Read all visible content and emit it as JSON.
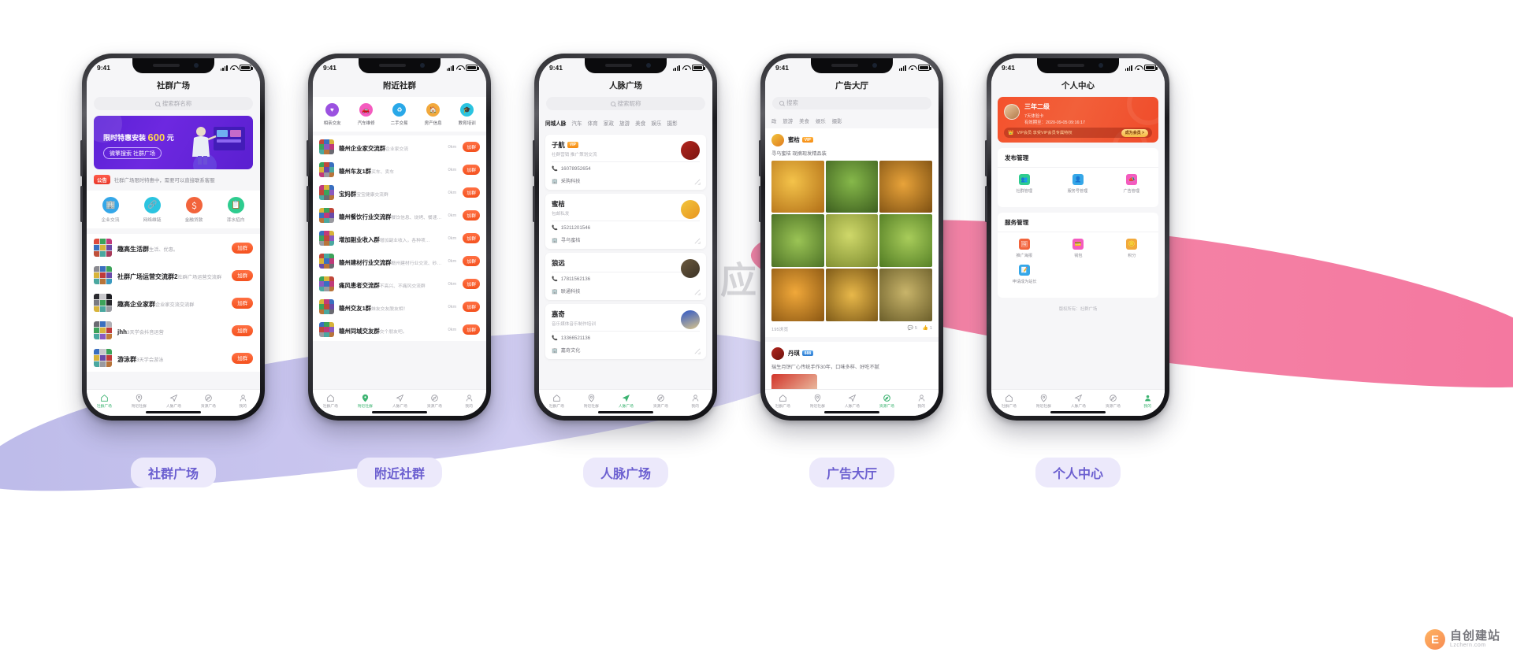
{
  "watermark": "微擎应用商城",
  "corner_logo": {
    "mark": "E",
    "line1": "自创建站",
    "line2": "Lzchern.com"
  },
  "status_bar": {
    "time": "9:41"
  },
  "captions": [
    "社群广场",
    "附近社群",
    "人脉广场",
    "广告大厅",
    "个人中心"
  ],
  "tabbar": {
    "items": [
      {
        "label": "社群广场",
        "icon": "home-icon"
      },
      {
        "label": "附近社群",
        "icon": "location-icon"
      },
      {
        "label": "人脉广场",
        "icon": "send-icon"
      },
      {
        "label": "资源广场",
        "icon": "compass-icon"
      },
      {
        "label": "我的",
        "icon": "user-icon"
      }
    ]
  },
  "phone1": {
    "title": "社群广场",
    "search_placeholder": "搜索群名称",
    "banner": {
      "line1_prefix": "限时特惠安装",
      "line1_num": "600",
      "line1_suffix": "元",
      "pill": "微擎搜索  社群广场"
    },
    "notice": {
      "tag": "公告",
      "text": "社群广场限时特惠中，需要可以直接联系客服"
    },
    "quick_entries": [
      {
        "label": "企业交流",
        "color": "#35a7e8",
        "glyph": "🏢"
      },
      {
        "label": "网络维链",
        "color": "#2bc4e0",
        "glyph": "🔗"
      },
      {
        "label": "金融贷款",
        "color": "#f2643c",
        "glyph": "$"
      },
      {
        "label": "漆水招白",
        "color": "#2ecc8f",
        "glyph": "📋"
      }
    ],
    "groups": [
      {
        "name": "趣高生活群",
        "desc": "生活、优惠。",
        "button": "加群"
      },
      {
        "name": "社群广场运营交流群2",
        "desc": "社群广场运营交流群",
        "button": "加群"
      },
      {
        "name": "趣高企业家群",
        "desc": "企业家交流交流群",
        "button": "加群"
      },
      {
        "name": "jhh",
        "desc": "3天学会抖音运营",
        "button": "加群"
      },
      {
        "name": "游泳群",
        "desc": "3天学会游泳",
        "button": "加群"
      }
    ],
    "active_tab": 0
  },
  "phone2": {
    "title": "附近社群",
    "categories": [
      {
        "label": "相亲交友",
        "color": "#9b51e0",
        "glyph": "♥"
      },
      {
        "label": "汽车维修",
        "color": "#f45bbf",
        "glyph": "🚗"
      },
      {
        "label": "二手交易",
        "color": "#29a8e8",
        "glyph": "♻"
      },
      {
        "label": "房产信息",
        "color": "#f2a93c",
        "glyph": "🏠"
      },
      {
        "label": "教育培训",
        "color": "#2bc4e0",
        "glyph": "🎓"
      }
    ],
    "groups": [
      {
        "name": "赣州企业家交流群",
        "desc": "企业家交流",
        "dist": "0km",
        "button": "加群"
      },
      {
        "name": "赣州车友1群",
        "desc": "买车、卖车",
        "dist": "0km",
        "button": "加群"
      },
      {
        "name": "宝妈群",
        "desc": "宝宝健康交流群",
        "dist": "0km",
        "button": "加群"
      },
      {
        "name": "赣州餐饮行业交流群",
        "desc": "餐饮信息、烧烤、餐速…",
        "dist": "0km",
        "button": "加群"
      },
      {
        "name": "增加副业收入群",
        "desc": "增加副业收入，各种项…",
        "dist": "0km",
        "button": "加群"
      },
      {
        "name": "赣州建材行业交流群",
        "desc": "赣州建材行业交流、砂…",
        "dist": "0km",
        "button": "加群"
      },
      {
        "name": "痛风患者交流群",
        "desc": "不高兴、不痛风交流群",
        "dist": "0km",
        "button": "加群"
      },
      {
        "name": "赣州交友1群",
        "desc": "妹友交友脱友相！",
        "dist": "0km",
        "button": "加群"
      },
      {
        "name": "赣州同城交友群",
        "desc": "交个朋友吧。",
        "dist": "0km",
        "button": "加群"
      }
    ],
    "active_tab": 1
  },
  "phone3": {
    "title": "人脉广场",
    "search_placeholder": "搜索昵称",
    "filters": [
      "同城人脉",
      "汽车",
      "体育",
      "家政",
      "旅游",
      "美食",
      "娱乐",
      "摄影"
    ],
    "active_filter": 0,
    "cards": [
      {
        "name": "子航",
        "vip": "VIP",
        "sub": "社群营销 推广策划交流",
        "phone": "16078952654",
        "company": "采购科技"
      },
      {
        "name": "蜜桔",
        "vip": "",
        "sub": "包邮私发",
        "phone": "15211201546",
        "company": "寻乌蜜桔"
      },
      {
        "name": "狼远",
        "vip": "",
        "sub": "",
        "phone": "17811562136",
        "company": "联通科技"
      },
      {
        "name": "嘉奇",
        "vip": "",
        "sub": "音乐媒体音乐制作培训",
        "phone": "13366521136",
        "company": "嘉奇文化"
      }
    ],
    "active_tab": 2
  },
  "phone4": {
    "title": "广告大厅",
    "search_placeholder": "搜索",
    "tags": [
      "政",
      "旅游",
      "美食",
      "娱乐",
      "摄影"
    ],
    "posts": [
      {
        "author": "蜜桔",
        "badge": "VIP",
        "text": "寻乌蜜桔 现摘现发精品装",
        "views": "195浏览",
        "comments": "5",
        "likes": "1"
      },
      {
        "author": "丹琪",
        "badge": "888",
        "text": "瑞生月饼厂心传统手作30年，口味多样、好吃不腻"
      }
    ],
    "active_tab": 3
  },
  "phone5": {
    "title": "个人中心",
    "vip": {
      "level": "三年二级",
      "tag": "7天体验卡",
      "expire_line1": "有效期至：2020-09-05 09:16:17",
      "bar_text": "VIP会员  享受VIP会员专属特权",
      "bar_button": "成为会员 >"
    },
    "sections": [
      {
        "title": "发布管理",
        "items": [
          {
            "label": "社群管理",
            "color": "#2ecc8f",
            "glyph": "👥"
          },
          {
            "label": "服务号管理",
            "color": "#35a7e8",
            "glyph": "👤"
          },
          {
            "label": "广告管理",
            "color": "#f45bbf",
            "glyph": "📣"
          }
        ]
      },
      {
        "title": "服务管理",
        "items": [
          {
            "label": "推广海报",
            "color": "#f2643c",
            "glyph": "🖼"
          },
          {
            "label": "钱包",
            "color": "#f45bbf",
            "glyph": "💳"
          },
          {
            "label": "积分",
            "color": "#f2a93c",
            "glyph": "🪙"
          },
          {
            "label": "申请成为站长",
            "color": "#35a7e8",
            "glyph": "📝"
          }
        ]
      }
    ],
    "copyright": "版权所有：社群广场",
    "active_tab": 4
  }
}
